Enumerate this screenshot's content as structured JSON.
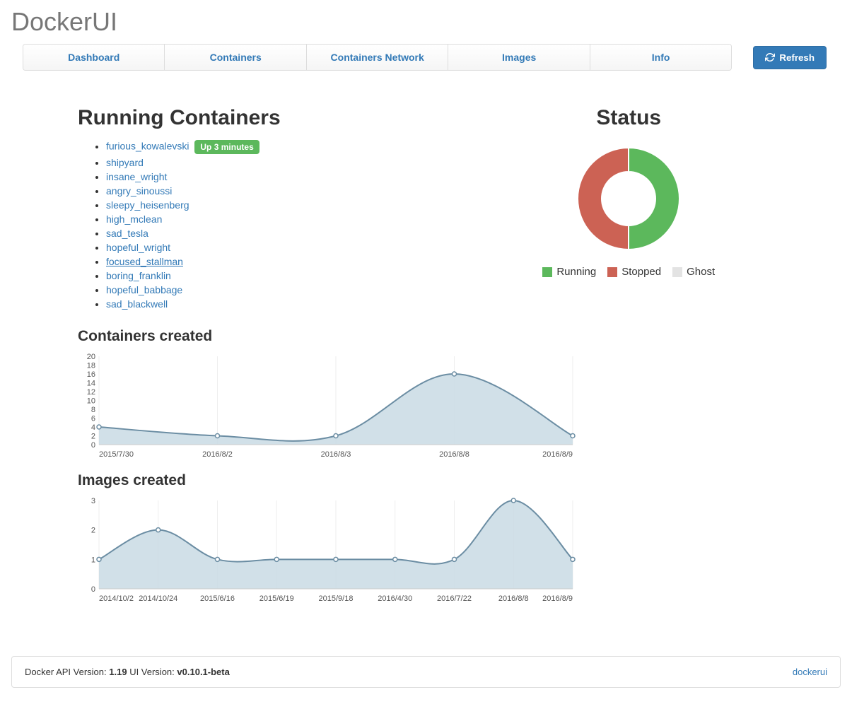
{
  "header": {
    "title": "DockerUI"
  },
  "nav": {
    "tabs": [
      "Dashboard",
      "Containers",
      "Containers Network",
      "Images",
      "Info"
    ],
    "refresh_label": "Refresh"
  },
  "running": {
    "title": "Running Containers",
    "badge": "Up 3 minutes",
    "items": [
      {
        "name": "furious_kowalevski",
        "badge": true
      },
      {
        "name": "shipyard"
      },
      {
        "name": "insane_wright"
      },
      {
        "name": "angry_sinoussi"
      },
      {
        "name": "sleepy_heisenberg"
      },
      {
        "name": "high_mclean"
      },
      {
        "name": "sad_tesla"
      },
      {
        "name": "hopeful_wright"
      },
      {
        "name": "focused_stallman",
        "underline": true
      },
      {
        "name": "boring_franklin"
      },
      {
        "name": "hopeful_babbage"
      },
      {
        "name": "sad_blackwell"
      }
    ]
  },
  "status": {
    "title": "Status",
    "legend": [
      {
        "label": "Running",
        "color": "#5cb85c"
      },
      {
        "label": "Stopped",
        "color": "#cc6254"
      },
      {
        "label": "Ghost",
        "color": "#e3e3e3"
      }
    ]
  },
  "chart_data": [
    {
      "type": "pie",
      "title": "Status",
      "series": [
        {
          "name": "Running",
          "value": 50,
          "color": "#5cb85c"
        },
        {
          "name": "Stopped",
          "value": 50,
          "color": "#cc6254"
        },
        {
          "name": "Ghost",
          "value": 0,
          "color": "#e3e3e3"
        }
      ],
      "donut": true
    },
    {
      "type": "area",
      "title": "Containers created",
      "x": [
        "2015/7/30",
        "2016/8/2",
        "2016/8/3",
        "2016/8/8",
        "2016/8/9"
      ],
      "values": [
        4,
        2,
        2,
        16,
        2
      ],
      "yticks": [
        0,
        2,
        4,
        6,
        8,
        10,
        12,
        14,
        16,
        18,
        20
      ],
      "ylim": [
        0,
        20
      ],
      "color_line": "#6b8da3",
      "color_fill": "#c9dae4"
    },
    {
      "type": "area",
      "title": "Images created",
      "x": [
        "2014/10/2",
        "2014/10/24",
        "2015/6/16",
        "2015/6/19",
        "2015/9/18",
        "2016/4/30",
        "2016/7/22",
        "2016/8/8",
        "2016/8/9"
      ],
      "values": [
        1,
        2,
        1,
        1,
        1,
        1,
        1,
        3,
        1
      ],
      "yticks": [
        0,
        1,
        2,
        3
      ],
      "ylim": [
        0,
        3
      ],
      "color_line": "#6b8da3",
      "color_fill": "#c9dae4"
    }
  ],
  "charts": {
    "containers_title": "Containers created",
    "images_title": "Images created"
  },
  "footer": {
    "api_label": "Docker API Version:",
    "api_version": "1.19",
    "ui_label": "UI Version:",
    "ui_version": "v0.10.1-beta",
    "link_label": "dockerui"
  }
}
